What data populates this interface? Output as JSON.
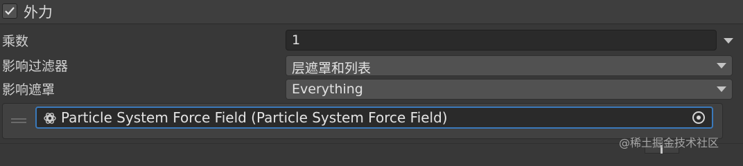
{
  "header": {
    "title": "外力",
    "enabled": true
  },
  "multiplier": {
    "label": "乘数",
    "value": "1"
  },
  "influence_filter": {
    "label": "影响过滤器",
    "value": "层遮罩和列表"
  },
  "influence_mask": {
    "label": "影响遮罩",
    "value": "Everything"
  },
  "force_list": {
    "items": [
      {
        "value": "Particle System Force Field (Particle System Force Field)",
        "icon": "particle-force-field-icon"
      }
    ]
  },
  "watermark": "@稀土掘金技术社区",
  "colors": {
    "accent": "#3a79bb",
    "background": "#383838",
    "header": "#3e3e3e"
  }
}
